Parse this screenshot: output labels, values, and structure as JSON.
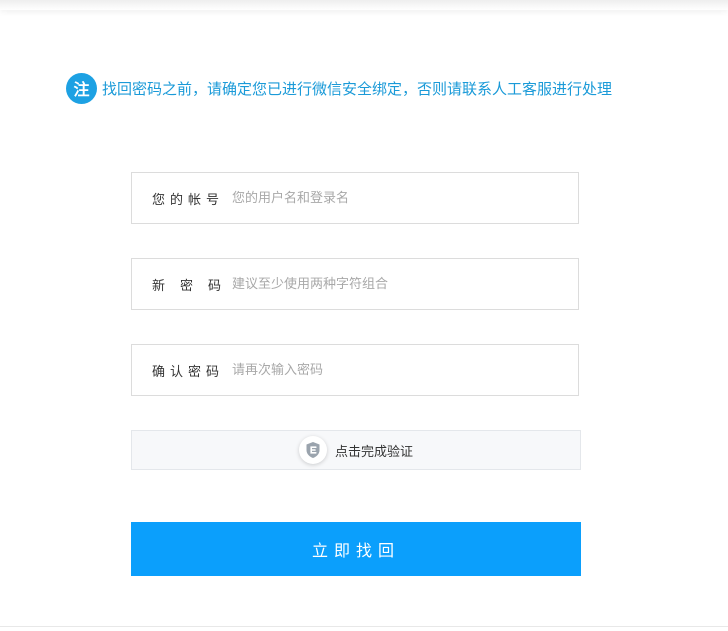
{
  "notice": {
    "badge": "注",
    "text": "找回密码之前，请确定您已进行微信安全绑定，否则请联系人工客服进行处理"
  },
  "form": {
    "account": {
      "label": "您的帐号",
      "placeholder": "您的用户名和登录名"
    },
    "new_password": {
      "label": "新密码",
      "placeholder": "建议至少使用两种字符组合"
    },
    "confirm_password": {
      "label": "确认密码",
      "placeholder": "请再次输入密码"
    },
    "captcha": {
      "text": "点击完成验证",
      "icon": "shield-icon"
    },
    "submit_label": "立即找回"
  },
  "colors": {
    "accent": "#0b9ffc",
    "notice_text": "#1a9ad8",
    "badge": "#1da1e3"
  }
}
